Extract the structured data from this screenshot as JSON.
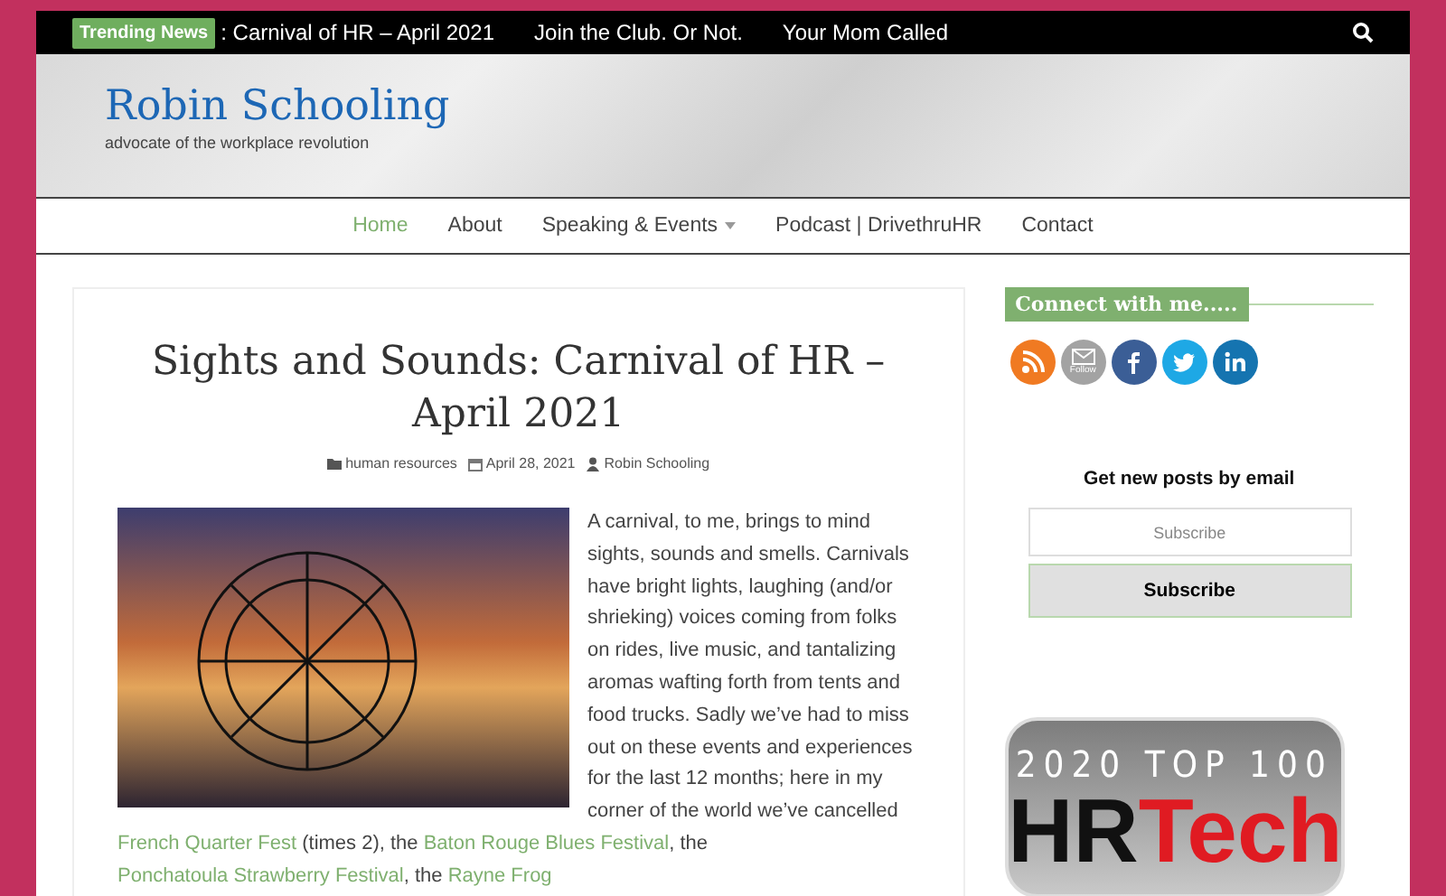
{
  "top_bar": {
    "badge": "Trending News",
    "headlines": [
      ": Carnival of HR – April 2021",
      "Join the Club. Or Not.",
      "Your Mom Called"
    ]
  },
  "header": {
    "site_title": "Robin Schooling",
    "tagline": "advocate of the workplace revolution"
  },
  "nav": {
    "items": [
      {
        "label": "Home",
        "selected": true,
        "has_submenu": false
      },
      {
        "label": "About",
        "selected": false,
        "has_submenu": false
      },
      {
        "label": "Speaking & Events",
        "selected": false,
        "has_submenu": true
      },
      {
        "label": "Podcast | DrivethruHR",
        "selected": false,
        "has_submenu": false
      },
      {
        "label": "Contact",
        "selected": false,
        "has_submenu": false
      }
    ]
  },
  "post": {
    "title": "Sights and Sounds: Carnival of HR – April 2021",
    "category": "human resources",
    "date": "April 28, 2021",
    "author": "Robin Schooling",
    "body": [
      {
        "kind": "text",
        "text": "A carnival, to me, brings to mind sights, sounds and smells. Carnivals have bright lights, laughing (and/or shrieking) voices coming from folks on rides, live music, and tantalizing aromas wafting forth from tents and food trucks. Sadly we’ve had to miss out on these events and experiences for the last 12 months; here in my corner of the world we’ve cancelled "
      },
      {
        "kind": "link",
        "text": "French Quarter Fest"
      },
      {
        "kind": "text",
        "text": " (times 2), the "
      },
      {
        "kind": "link",
        "text": "Baton Rouge Blues Festival"
      },
      {
        "kind": "text",
        "text": ", the "
      },
      {
        "kind": "link",
        "text": "Ponchatoula Strawberry Festival"
      },
      {
        "kind": "text",
        "text": ", the "
      },
      {
        "kind": "link",
        "text": "Rayne Frog"
      }
    ]
  },
  "sidebar": {
    "connect_heading": "Connect with me.....",
    "social": [
      {
        "kind": "rss",
        "color": "#f07a22"
      },
      {
        "kind": "email",
        "label": "Follow",
        "color": "#a3a3a3"
      },
      {
        "kind": "facebook",
        "color": "#3b5e96"
      },
      {
        "kind": "twitter",
        "color": "#1ea8e5"
      },
      {
        "kind": "linkedin",
        "color": "#1574b0"
      }
    ],
    "subscribe_heading": "Get new posts by email",
    "email_placeholder": "Subscribe",
    "subscribe_button": "Subscribe",
    "award": {
      "line1": "2020 TOP 100",
      "word1": "HR",
      "word2": "Tech"
    }
  }
}
